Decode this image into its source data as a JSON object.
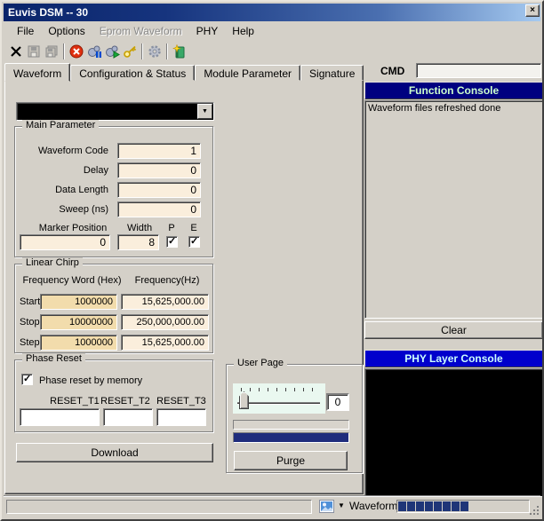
{
  "window": {
    "title": "Euvis DSM -- 30"
  },
  "glyphs": {
    "close": "×",
    "dropdown": "▼",
    "check": "✓"
  },
  "menu": {
    "items": [
      {
        "label": "File",
        "enabled": true
      },
      {
        "label": "Options",
        "enabled": true
      },
      {
        "label": "Eprom Waveform",
        "enabled": false
      },
      {
        "label": "PHY",
        "enabled": true
      },
      {
        "label": "Help",
        "enabled": true
      }
    ]
  },
  "toolbar": {
    "icons": [
      "delete-icon",
      "save-icon",
      "save-all-icon",
      "stop-icon",
      "process-pause-icon",
      "process-run-icon",
      "key-icon",
      "settings-gear-icon",
      "new-log-icon"
    ]
  },
  "tabs": [
    {
      "label": "Waveform",
      "active": true
    },
    {
      "label": "Configuration & Status",
      "active": false
    },
    {
      "label": "Module Parameter",
      "active": false
    },
    {
      "label": "Signature",
      "active": false
    }
  ],
  "waveform_combo": {
    "value": ""
  },
  "main_parameter": {
    "title": "Main Parameter",
    "fields": [
      {
        "label": "Waveform Code",
        "value": "1"
      },
      {
        "label": "Delay",
        "value": "0"
      },
      {
        "label": "Data Length",
        "value": "0"
      },
      {
        "label": "Sweep (ns)",
        "value": "0"
      }
    ],
    "marker": {
      "position_label": "Marker Position",
      "width_label": "Width",
      "p_label": "P",
      "e_label": "E",
      "position_value": "0",
      "width_value": "8",
      "p_checked": true,
      "e_checked": true
    }
  },
  "linear_chirp": {
    "title": "Linear Chirp",
    "col_hex": "Frequency Word (Hex)",
    "col_hz": "Frequency(Hz)",
    "rows": [
      {
        "label": "Start",
        "hex": "1000000",
        "hz": "15,625,000.00"
      },
      {
        "label": "Stop",
        "hex": "10000000",
        "hz": "250,000,000.00"
      },
      {
        "label": "Step",
        "hex": "1000000",
        "hz": "15,625,000.00"
      }
    ]
  },
  "phase_reset": {
    "title": "Phase Reset",
    "checkbox_label": "Phase reset by memory",
    "checked": true,
    "reset_labels": [
      "RESET_T1",
      "RESET_T2",
      "RESET_T3"
    ],
    "reset_values": [
      "",
      "",
      ""
    ]
  },
  "download_button": "Download",
  "user_page": {
    "title": "User Page",
    "value": "0",
    "purge_button": "Purge"
  },
  "cmd": {
    "label": "CMD",
    "value": ""
  },
  "function_console": {
    "title": "Function Console",
    "messages": [
      "Waveform files refreshed done"
    ],
    "clear_button": "Clear"
  },
  "phy_console": {
    "title": "PHY Layer Console"
  },
  "status_bar": {
    "mode_label": "Waveform",
    "progress_segments": 8
  },
  "colors": {
    "titlebar_start": "#0A246A",
    "titlebar_end": "#A6CAF0",
    "function_console_header": "#000080",
    "phy_console_header": "#0000CC",
    "console_header_text": "#CCFFCC",
    "field_cream": "#FAEEDC",
    "field_wheat": "#F2DCAC",
    "navy_bar": "#1F2C7C",
    "progress_segment": "#1F3578",
    "window_bg": "#D4D0C8"
  }
}
